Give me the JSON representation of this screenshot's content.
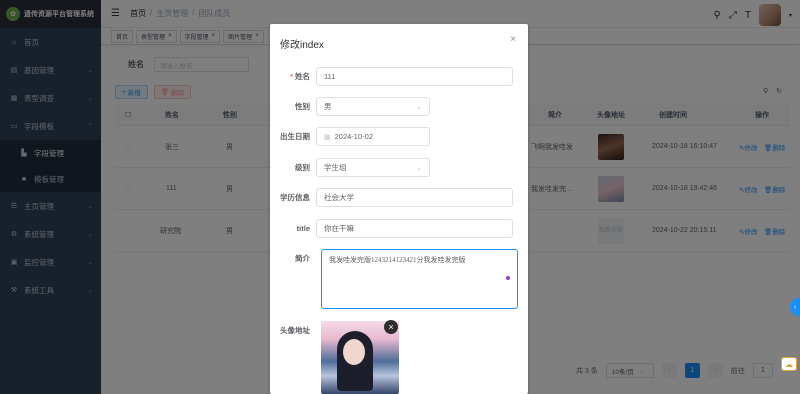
{
  "app": {
    "title": "遗传资源平台管理系统"
  },
  "sidebar": {
    "items": [
      {
        "label": "首页",
        "icon": "home-icon"
      },
      {
        "label": "基因管理",
        "icon": "dna-icon",
        "expandable": true
      },
      {
        "label": "表型调查",
        "icon": "survey-icon",
        "expandable": true
      },
      {
        "label": "字段模板",
        "icon": "template-icon",
        "expandable": true,
        "expanded": true,
        "children": [
          {
            "label": "字段管理",
            "icon": "field-icon"
          },
          {
            "label": "模板管理",
            "icon": "grid-icon"
          }
        ]
      },
      {
        "label": "主页管理",
        "icon": "list-icon",
        "expandable": true
      },
      {
        "label": "系统管理",
        "icon": "gear-icon",
        "expandable": true
      },
      {
        "label": "监控管理",
        "icon": "monitor-icon",
        "expandable": true
      },
      {
        "label": "系统工具",
        "icon": "tool-icon",
        "expandable": true
      }
    ]
  },
  "navbar": {
    "breadcrumb": [
      "首页",
      "主页管理",
      "团队成员"
    ],
    "font_icon": "T"
  },
  "tags": [
    {
      "label": "首页",
      "closable": false
    },
    {
      "label": "表型管理",
      "closable": true
    },
    {
      "label": "字段管理",
      "closable": true
    },
    {
      "label": "图片管理",
      "closable": true
    }
  ],
  "search": {
    "label": "姓名",
    "placeholder": "请输入姓名"
  },
  "actions": {
    "add": "新增",
    "delete": "删除"
  },
  "table": {
    "headers": [
      "姓名",
      "性别",
      "简介",
      "头像地址",
      "创建时间",
      "操作"
    ],
    "rows": [
      {
        "name": "张三",
        "gender": "男",
        "intro": "飞啊我发哇发",
        "avatar": "image",
        "created": "2024-10-18 16:10:47"
      },
      {
        "name": "111",
        "gender": "男",
        "intro": "我发哇发完...",
        "avatar": "image",
        "created": "2024-10-18 19:42:46"
      },
      {
        "name": "研究院",
        "gender": "男",
        "intro": "",
        "avatar": "加载失败",
        "created": "2024-10-22 20:15:11"
      }
    ],
    "ops": {
      "edit": "修改",
      "delete": "删除"
    }
  },
  "pagination": {
    "total_text": "共 3 条",
    "page_size": "10条/页",
    "current_page": "1",
    "goto_label": "前往",
    "goto_value": "1"
  },
  "dialog": {
    "title": "修改index",
    "fields": {
      "name": {
        "label": "姓名",
        "value": "111",
        "required": true
      },
      "gender": {
        "label": "性别",
        "value": "男"
      },
      "birth": {
        "label": "出生日期",
        "value": "2024-10-02"
      },
      "level": {
        "label": "级别",
        "value": "学生组"
      },
      "education": {
        "label": "学历信息",
        "value": "社会大学"
      },
      "title": {
        "label": "title",
        "value": "你在干嘛"
      },
      "intro": {
        "label": "简介",
        "value": "我发哇发完版1243214123421分我发哇发完版"
      },
      "avatar": {
        "label": "头像地址"
      }
    }
  },
  "colors": {
    "primary": "#1890ff",
    "sidebar": "#304156",
    "danger": "#f56c6c"
  }
}
